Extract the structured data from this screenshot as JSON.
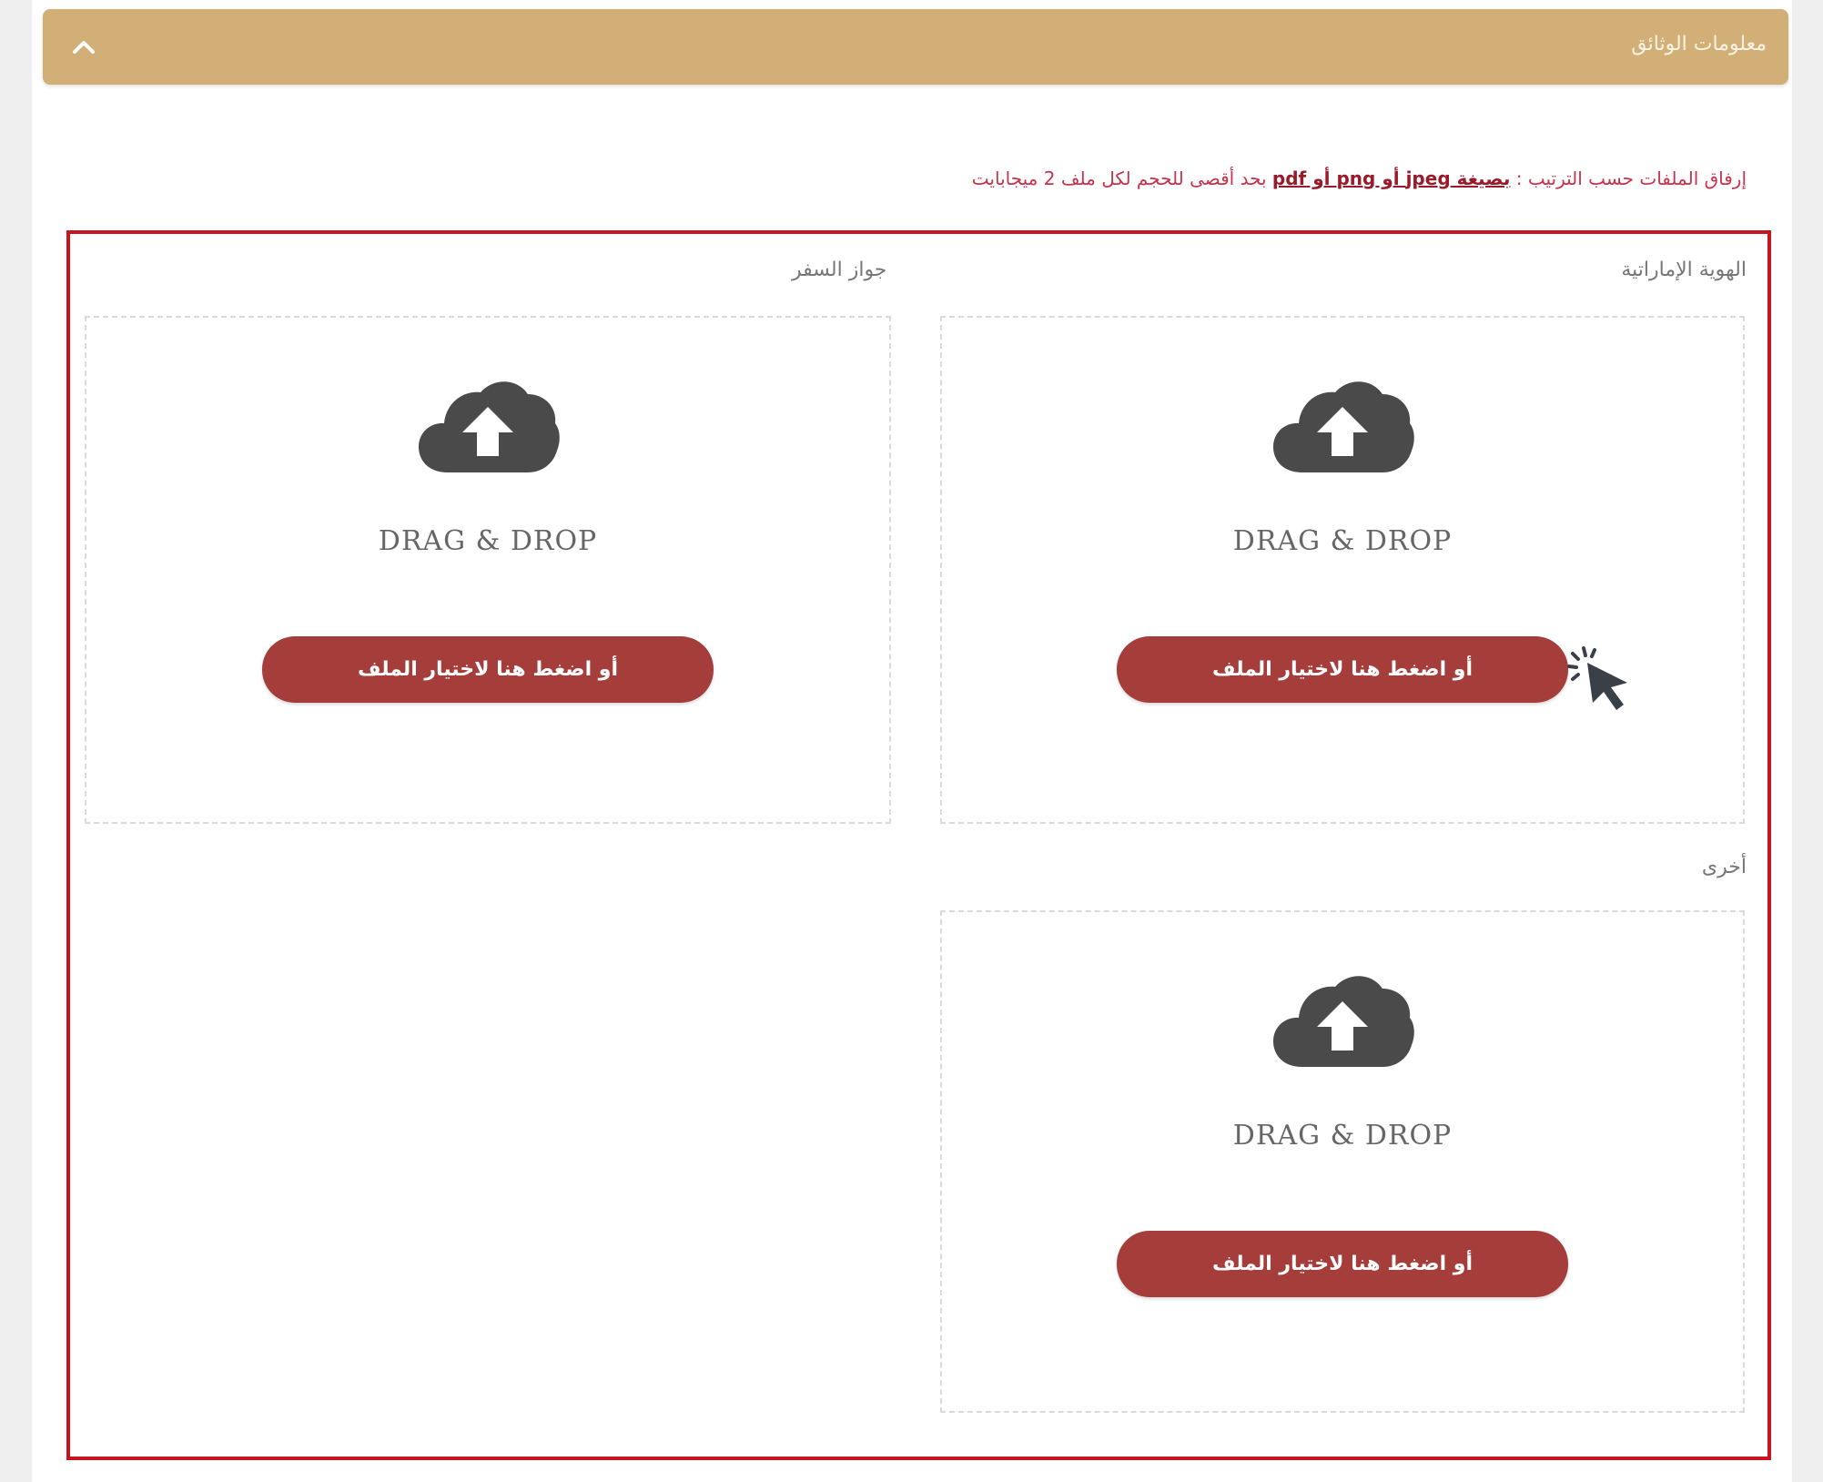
{
  "header": {
    "title": "معلومات الوثائق",
    "collapse_icon": "chevron-up-icon",
    "bg_color": "#d2af77"
  },
  "instruction": {
    "prefix": "إرفاق الملفات حسب الترتيب : ",
    "emphasis": "بصيغة jpeg أو png أو pdf",
    "suffix": " بحد أقصى للحجم لكل ملف 2 ميجابايت",
    "color": "#c8324a"
  },
  "uploads": [
    {
      "label": "الهوية الإماراتية",
      "drop_text": "DRAG & DROP",
      "button_label": "أو اضغط هنا لاختيار الملف",
      "icon": "cloud-upload-icon"
    },
    {
      "label": "جواز السفر",
      "drop_text": "DRAG & DROP",
      "button_label": "أو اضغط هنا لاختيار الملف",
      "icon": "cloud-upload-icon"
    },
    {
      "label": "أخرى",
      "drop_text": "DRAG & DROP",
      "button_label": "أو اضغط هنا لاختيار الملف",
      "icon": "cloud-upload-icon"
    }
  ],
  "colors": {
    "button": "#a53d3b",
    "highlight": "#c8141e",
    "icon": "#4a4a4a"
  }
}
